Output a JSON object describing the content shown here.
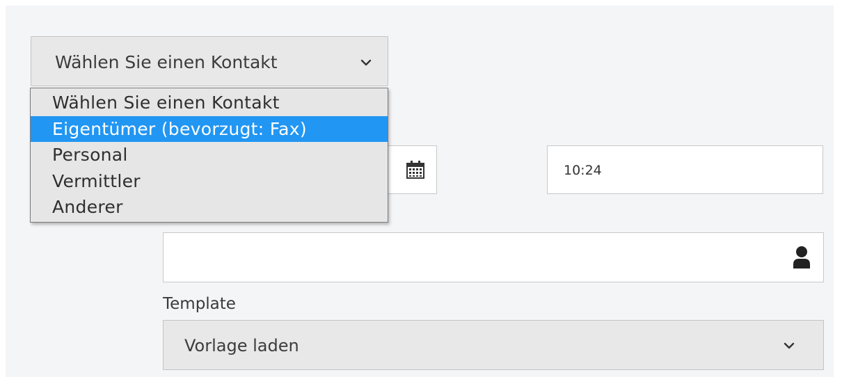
{
  "contact_select": {
    "value": "Wählen Sie einen Kontakt",
    "options": [
      "Wählen Sie einen Kontakt",
      "Eigentümer (bevorzugt: Fax)",
      "Personal",
      "Vermittler",
      "Anderer"
    ],
    "highlighted_index": 1
  },
  "date_field": {
    "value": "",
    "icon": "calendar-icon"
  },
  "time_field": {
    "value": "10:24"
  },
  "recipient_field": {
    "value": "",
    "icon": "person-icon"
  },
  "template": {
    "label": "Template",
    "value": "Vorlage laden"
  },
  "colors": {
    "highlight": "#2196f3",
    "select_background": "#e8e8e8",
    "panel_background": "#f4f5f7"
  }
}
